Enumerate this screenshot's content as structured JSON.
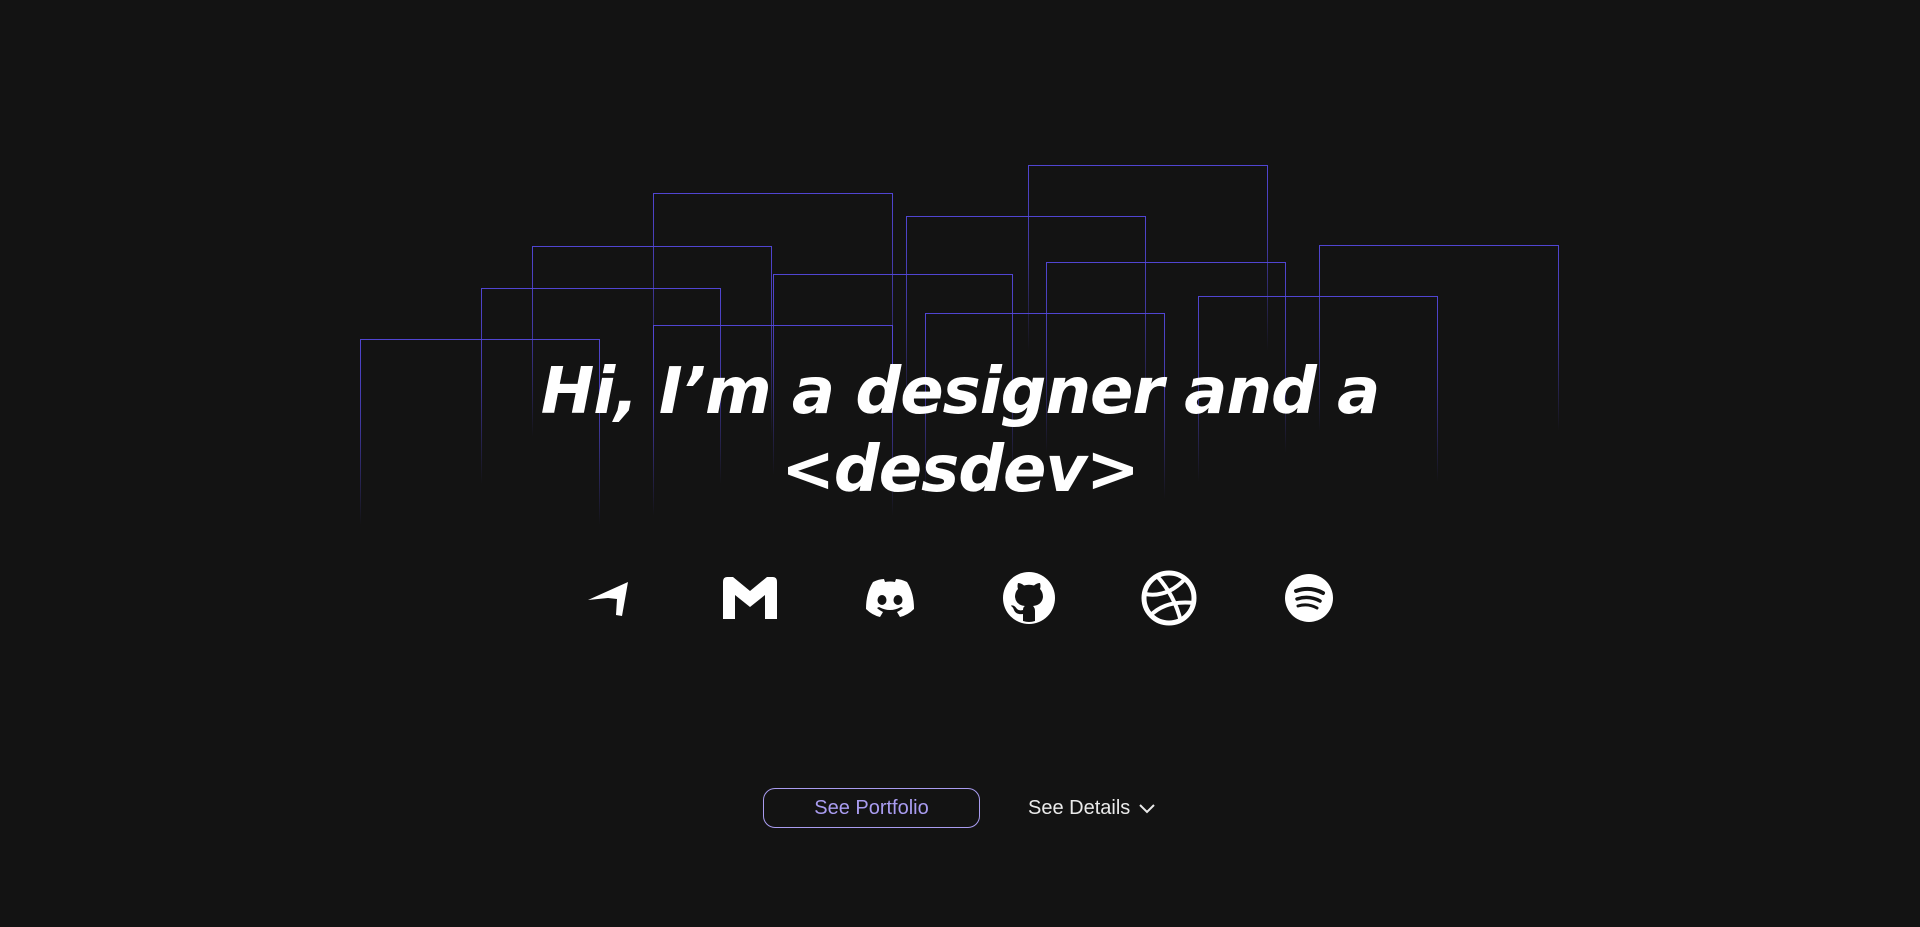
{
  "hero": {
    "line1": "Hi, I’m a designer and a",
    "line2": "<desdev>"
  },
  "socials": [
    {
      "icon": "telegram-icon"
    },
    {
      "icon": "gmail-icon"
    },
    {
      "icon": "discord-icon"
    },
    {
      "icon": "github-icon"
    },
    {
      "icon": "dribbble-icon"
    },
    {
      "icon": "spotify-icon"
    }
  ],
  "actions": {
    "portfolio_label": "See Portfolio",
    "details_label": "See Details"
  },
  "colors": {
    "background": "#131313",
    "accent": "#a99cf0",
    "frame_line": "#5448dc",
    "text": "#ffffff"
  }
}
